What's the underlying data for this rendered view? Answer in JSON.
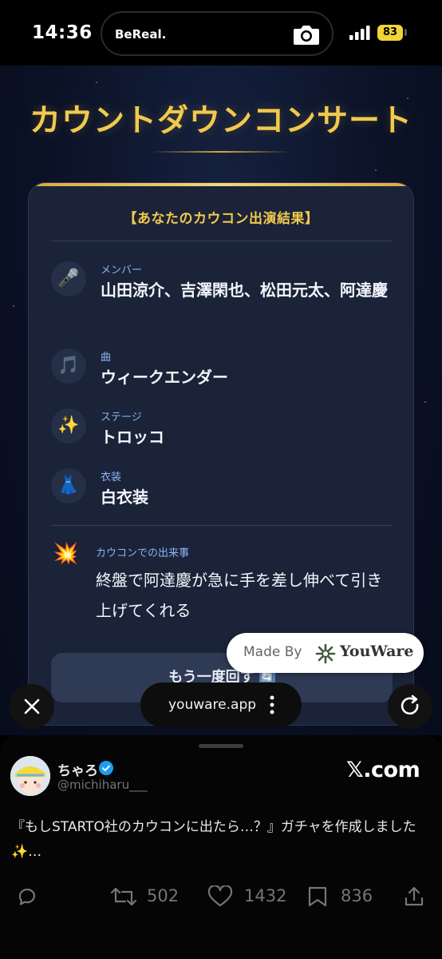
{
  "status_bar": {
    "time": "14:36",
    "island_app": "BeReal.",
    "battery": "83",
    "icons": [
      "camera-icon",
      "signal-icon",
      "battery-icon"
    ]
  },
  "page": {
    "title": "カウントダウンコンサート",
    "card_heading": "【あなたのカウコン出演結果】",
    "rows": [
      {
        "icon": "🎤",
        "icon_name": "microphone-icon",
        "label": "メンバー",
        "value": "山田涼介、吉澤閑也、松田元太、阿達慶"
      },
      {
        "icon": "🎵",
        "icon_name": "music-note-icon",
        "label": "曲",
        "value": "ウィークエンダー"
      },
      {
        "icon": "✨",
        "icon_name": "sparkles-icon",
        "label": "ステージ",
        "value": "トロッコ"
      },
      {
        "icon": "👗",
        "icon_name": "dress-icon",
        "label": "衣装",
        "value": "白衣装"
      }
    ],
    "event": {
      "icon": "💥",
      "icon_name": "explosion-icon",
      "label": "カウコンでの出来事",
      "text": "終盤で阿達慶が急に手を差し伸べて引き上げてくれる"
    },
    "retry_label": "もう一度回す",
    "retry_icon": "🔄",
    "made_by": "Made By",
    "made_by_brand": "YouWare"
  },
  "browser": {
    "url": "youware.app",
    "colors": {
      "accent_gold": "#f2c94c",
      "label_blue": "#8fb4f5"
    }
  },
  "tweet": {
    "display_name": "ちゃろ",
    "handle": "@michiharu___",
    "source": "𝕏.com",
    "text": "『もしSTARTO社のカウコンに出たら…？』ガチャを作成しました✨…",
    "retweets": "502",
    "likes": "1432",
    "bookmarks": "836",
    "verified_color": "#1d9bf0"
  }
}
